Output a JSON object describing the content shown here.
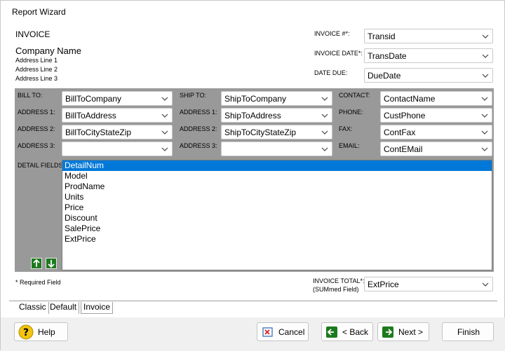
{
  "window": {
    "title": "Report Wizard"
  },
  "header": {
    "invoice_label": "INVOICE",
    "company_name": "Company Name",
    "address_lines": [
      "Address Line 1",
      "Address Line 2",
      "Address Line 3"
    ]
  },
  "invoice_fields": [
    {
      "label": "INVOICE #*:",
      "value": "Transid"
    },
    {
      "label": "INVOICE DATE*:",
      "value": "TransDate"
    },
    {
      "label": "DATE DUE:",
      "value": "DueDate"
    }
  ],
  "bill_to": {
    "labels": [
      "BILL TO:",
      "ADDRESS 1:",
      "ADDRESS 2:",
      "ADDRESS 3:"
    ],
    "values": [
      "BillToCompany",
      "BillToAddress",
      "BillToCityStateZip",
      ""
    ]
  },
  "ship_to": {
    "labels": [
      "SHIP TO:",
      "ADDRESS 1:",
      "ADDRESS 2:",
      "ADDRESS 3:"
    ],
    "values": [
      "ShipToCompany",
      "ShipToAddress",
      "ShipToCityStateZip",
      ""
    ]
  },
  "contact": {
    "labels": [
      "CONTACT:",
      "PHONE:",
      "FAX:",
      "EMAIL:"
    ],
    "values": [
      "ContactName",
      "CustPhone",
      "ContFax",
      "ContEMail"
    ]
  },
  "detail": {
    "label": "DETAIL FIELDS:",
    "items": [
      "DetailNum",
      "Model",
      "ProdName",
      "Units",
      "Price",
      "Discount",
      "SalePrice",
      "ExtPrice"
    ],
    "selected_index": 0
  },
  "required_note": "* Required Field",
  "invoice_total": {
    "label_line1": "INVOICE TOTAL*:",
    "label_line2": "(SUMmed Field)",
    "value": "ExtPrice"
  },
  "tabs": [
    {
      "label": "Classic",
      "active": false
    },
    {
      "label": "Default",
      "active": false
    },
    {
      "label": "Invoice",
      "active": true
    }
  ],
  "buttons": {
    "help": "Help",
    "cancel": "Cancel",
    "back": "< Back",
    "next": "Next >",
    "finish": "Finish"
  },
  "colors": {
    "panel_gray": "#999999",
    "selection": "#0078d7",
    "arrow_green": "#1d7a1d"
  },
  "icons": [
    "chevron-down-icon",
    "arrow-up-icon",
    "arrow-down-icon",
    "help-icon",
    "cancel-icon",
    "arrow-left-icon",
    "arrow-right-icon"
  ]
}
